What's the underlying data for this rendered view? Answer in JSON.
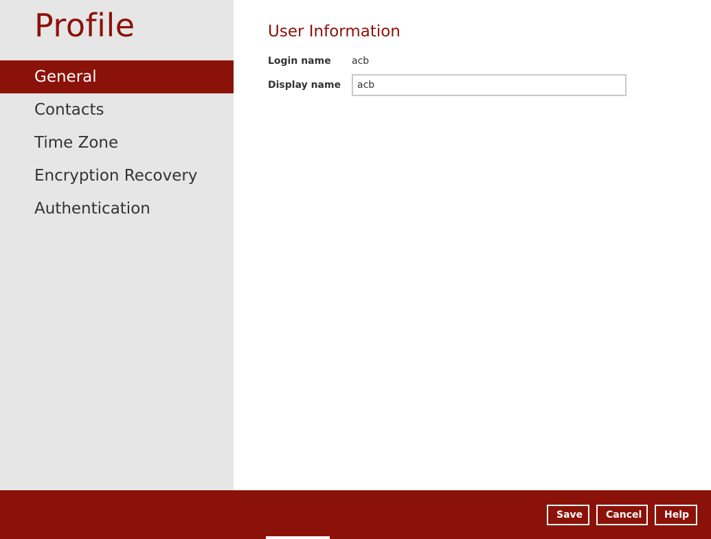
{
  "sidebar": {
    "title": "Profile",
    "items": [
      {
        "label": "General",
        "active": true
      },
      {
        "label": "Contacts",
        "active": false
      },
      {
        "label": "Time Zone",
        "active": false
      },
      {
        "label": "Encryption Recovery",
        "active": false
      },
      {
        "label": "Authentication",
        "active": false
      }
    ]
  },
  "main": {
    "section_title": "User Information",
    "login_name_label": "Login name",
    "login_name_value": "acb",
    "display_name_label": "Display name",
    "display_name_value": "acb"
  },
  "footer": {
    "save_label": "Save",
    "cancel_label": "Cancel",
    "help_label": "Help"
  },
  "colors": {
    "accent": "#8b1208",
    "sidebar_bg": "#e6e6e6"
  }
}
